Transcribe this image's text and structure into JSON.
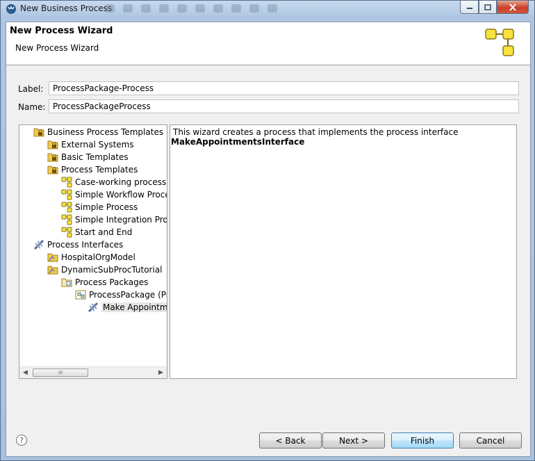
{
  "window": {
    "title": "New Business Process"
  },
  "header": {
    "title": "New Process Wizard",
    "subtitle": "New Process Wizard"
  },
  "form": {
    "label_caption": "Label:",
    "label_value": "ProcessPackage-Process",
    "name_caption": "Name:",
    "name_value": "ProcessPackageProcess"
  },
  "tree": {
    "items": [
      {
        "label": "Business Process Templates",
        "icon": "locked-folder-icon"
      },
      {
        "label": "External Systems",
        "icon": "locked-folder-icon"
      },
      {
        "label": "Basic Templates",
        "icon": "locked-folder-icon"
      },
      {
        "label": "Process Templates",
        "icon": "locked-folder-icon"
      },
      {
        "label": "Case-working process",
        "icon": "process-icon"
      },
      {
        "label": "Simple Workflow Process",
        "icon": "process-icon"
      },
      {
        "label": "Simple Process",
        "icon": "process-icon"
      },
      {
        "label": "Simple Integration Process",
        "icon": "process-icon"
      },
      {
        "label": "Start and End",
        "icon": "process-icon"
      },
      {
        "label": "Process Interfaces",
        "icon": "process-interface-icon"
      },
      {
        "label": "HospitalOrgModel",
        "icon": "project-folder-icon"
      },
      {
        "label": "DynamicSubProcTutorial",
        "icon": "project-folder-icon"
      },
      {
        "label": "Process Packages",
        "icon": "package-folder-icon"
      },
      {
        "label": "ProcessPackage (Pro",
        "icon": "package-icon"
      },
      {
        "label": "Make Appointme",
        "icon": "process-interface-icon"
      }
    ],
    "scroll_grip": "III"
  },
  "description": {
    "text": "This wizard creates a process that implements the process interface",
    "interface_name": "MakeAppointmentsInterface"
  },
  "footer": {
    "help": "?",
    "back": "< Back",
    "next": "Next >",
    "finish": "Finish",
    "cancel": "Cancel"
  },
  "colors": {
    "process_yellow": "#f7e23e",
    "selection": "#e6e6e6",
    "default_button": "#3c7fb1"
  }
}
